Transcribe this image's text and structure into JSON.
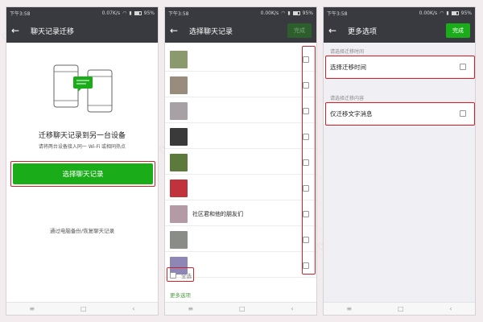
{
  "statusbar": {
    "time": "下午3:58",
    "speed_p1": "0.07K/s",
    "speed_p2": "0.00K/s",
    "speed_p3": "0.00K/s",
    "battery": "95%"
  },
  "screen1": {
    "title": "聊天记录迁移",
    "heading": "迁移聊天记录到另一台设备",
    "subtext": "请将两台设备接入同一 Wi-Fi 或相同热点",
    "primary_button": "选择聊天记录",
    "backup_link": "通过电脑备份/恢复聊天记录"
  },
  "screen2": {
    "title": "选择聊天记录",
    "done_label": "完成",
    "chats": [
      {
        "name": "",
        "avatar_color": "#8b9a6c"
      },
      {
        "name": "",
        "avatar_color": "#9a8c7c"
      },
      {
        "name": "",
        "avatar_color": "#a7a1a6"
      },
      {
        "name": "",
        "avatar_color": "#3a3a3a"
      },
      {
        "name": "",
        "avatar_color": "#5b7a3b"
      },
      {
        "name": "",
        "avatar_color": "#c2323c"
      },
      {
        "name": "社区君和他的朋友们",
        "avatar_color": "#b49aa5"
      },
      {
        "name": "",
        "avatar_color": "#8a8c88"
      },
      {
        "name": "",
        "avatar_color": "#8e87b5"
      }
    ],
    "select_all": "全选",
    "more_options": "更多选项"
  },
  "screen3": {
    "title": "更多选项",
    "done_label": "完成",
    "time_section_label": "请选择迁移时间",
    "time_option": "选择迁移时间",
    "content_section_label": "请选择迁移内容",
    "content_option": "仅迁移文字消息"
  },
  "colors": {
    "brand_green": "#1aad19",
    "titlebar": "#393a3f",
    "highlight_red": "#d3212b"
  }
}
